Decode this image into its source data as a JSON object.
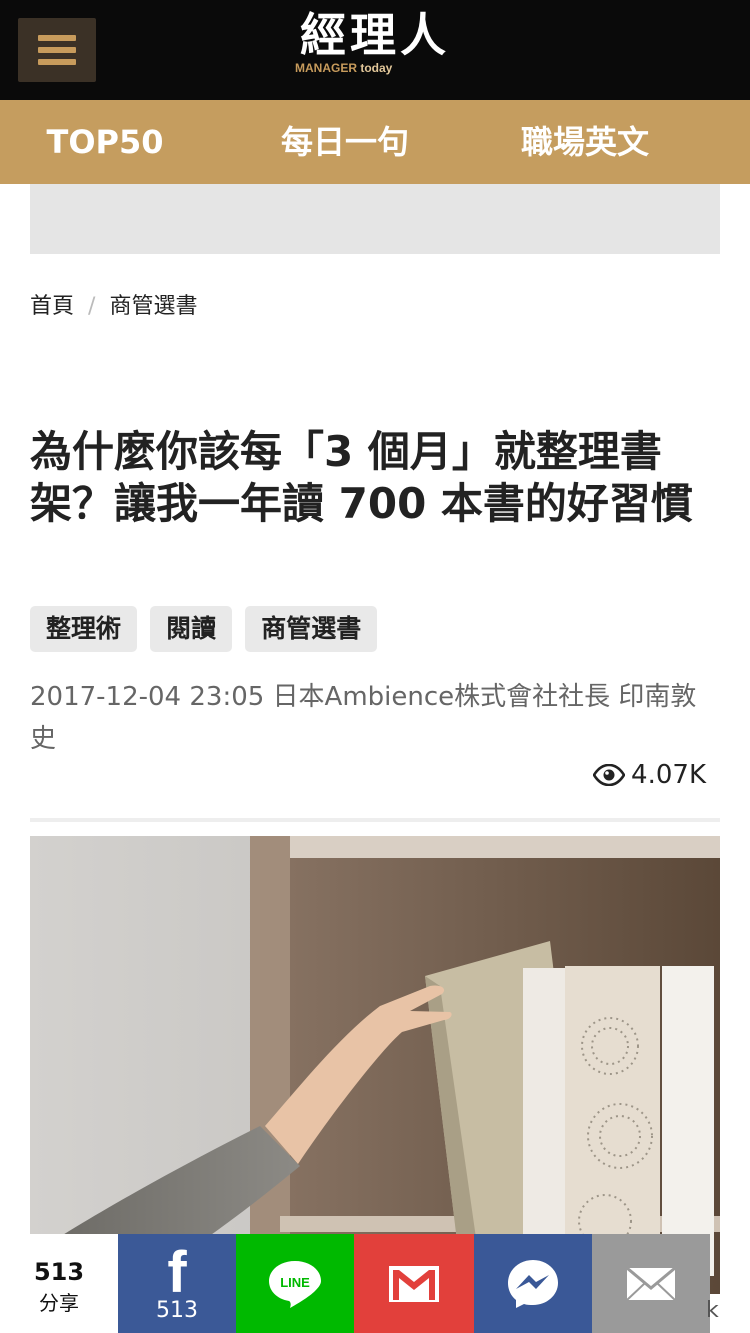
{
  "header": {
    "logo_text": "經理人",
    "logo_sub_a": "MANAGER",
    "logo_sub_b": "today",
    "menu_icon": "hamburger-icon"
  },
  "nav": {
    "items": [
      {
        "label": "TOP50"
      },
      {
        "label": "每日一句"
      },
      {
        "label": "職場英文"
      }
    ]
  },
  "breadcrumb": {
    "home": "首頁",
    "separator": "/",
    "category": "商管選書"
  },
  "article": {
    "title": "為什麼你該每「3 個月」就整理書架？讓我一年讀 700 本書的好習慣",
    "tags": [
      "整理術",
      "閱讀",
      "商管選書"
    ],
    "meta": "2017-12-04 23:05 日本Ambience株式會社社長 印南敦史",
    "views": "4.07K",
    "hero_image_alt": "hand pulling a book from a bookshelf"
  },
  "share": {
    "count": "513",
    "count_label": "分享",
    "facebook_count": "513",
    "line_label": "LINE",
    "corner_text": "k"
  },
  "colors": {
    "topbar": "#0a0a0a",
    "accent_gold": "#c59d5f",
    "facebook": "#3b5997",
    "line": "#00b900",
    "gmail": "#e2403b",
    "messenger": "#3a5897",
    "email": "#9a9a9a"
  }
}
